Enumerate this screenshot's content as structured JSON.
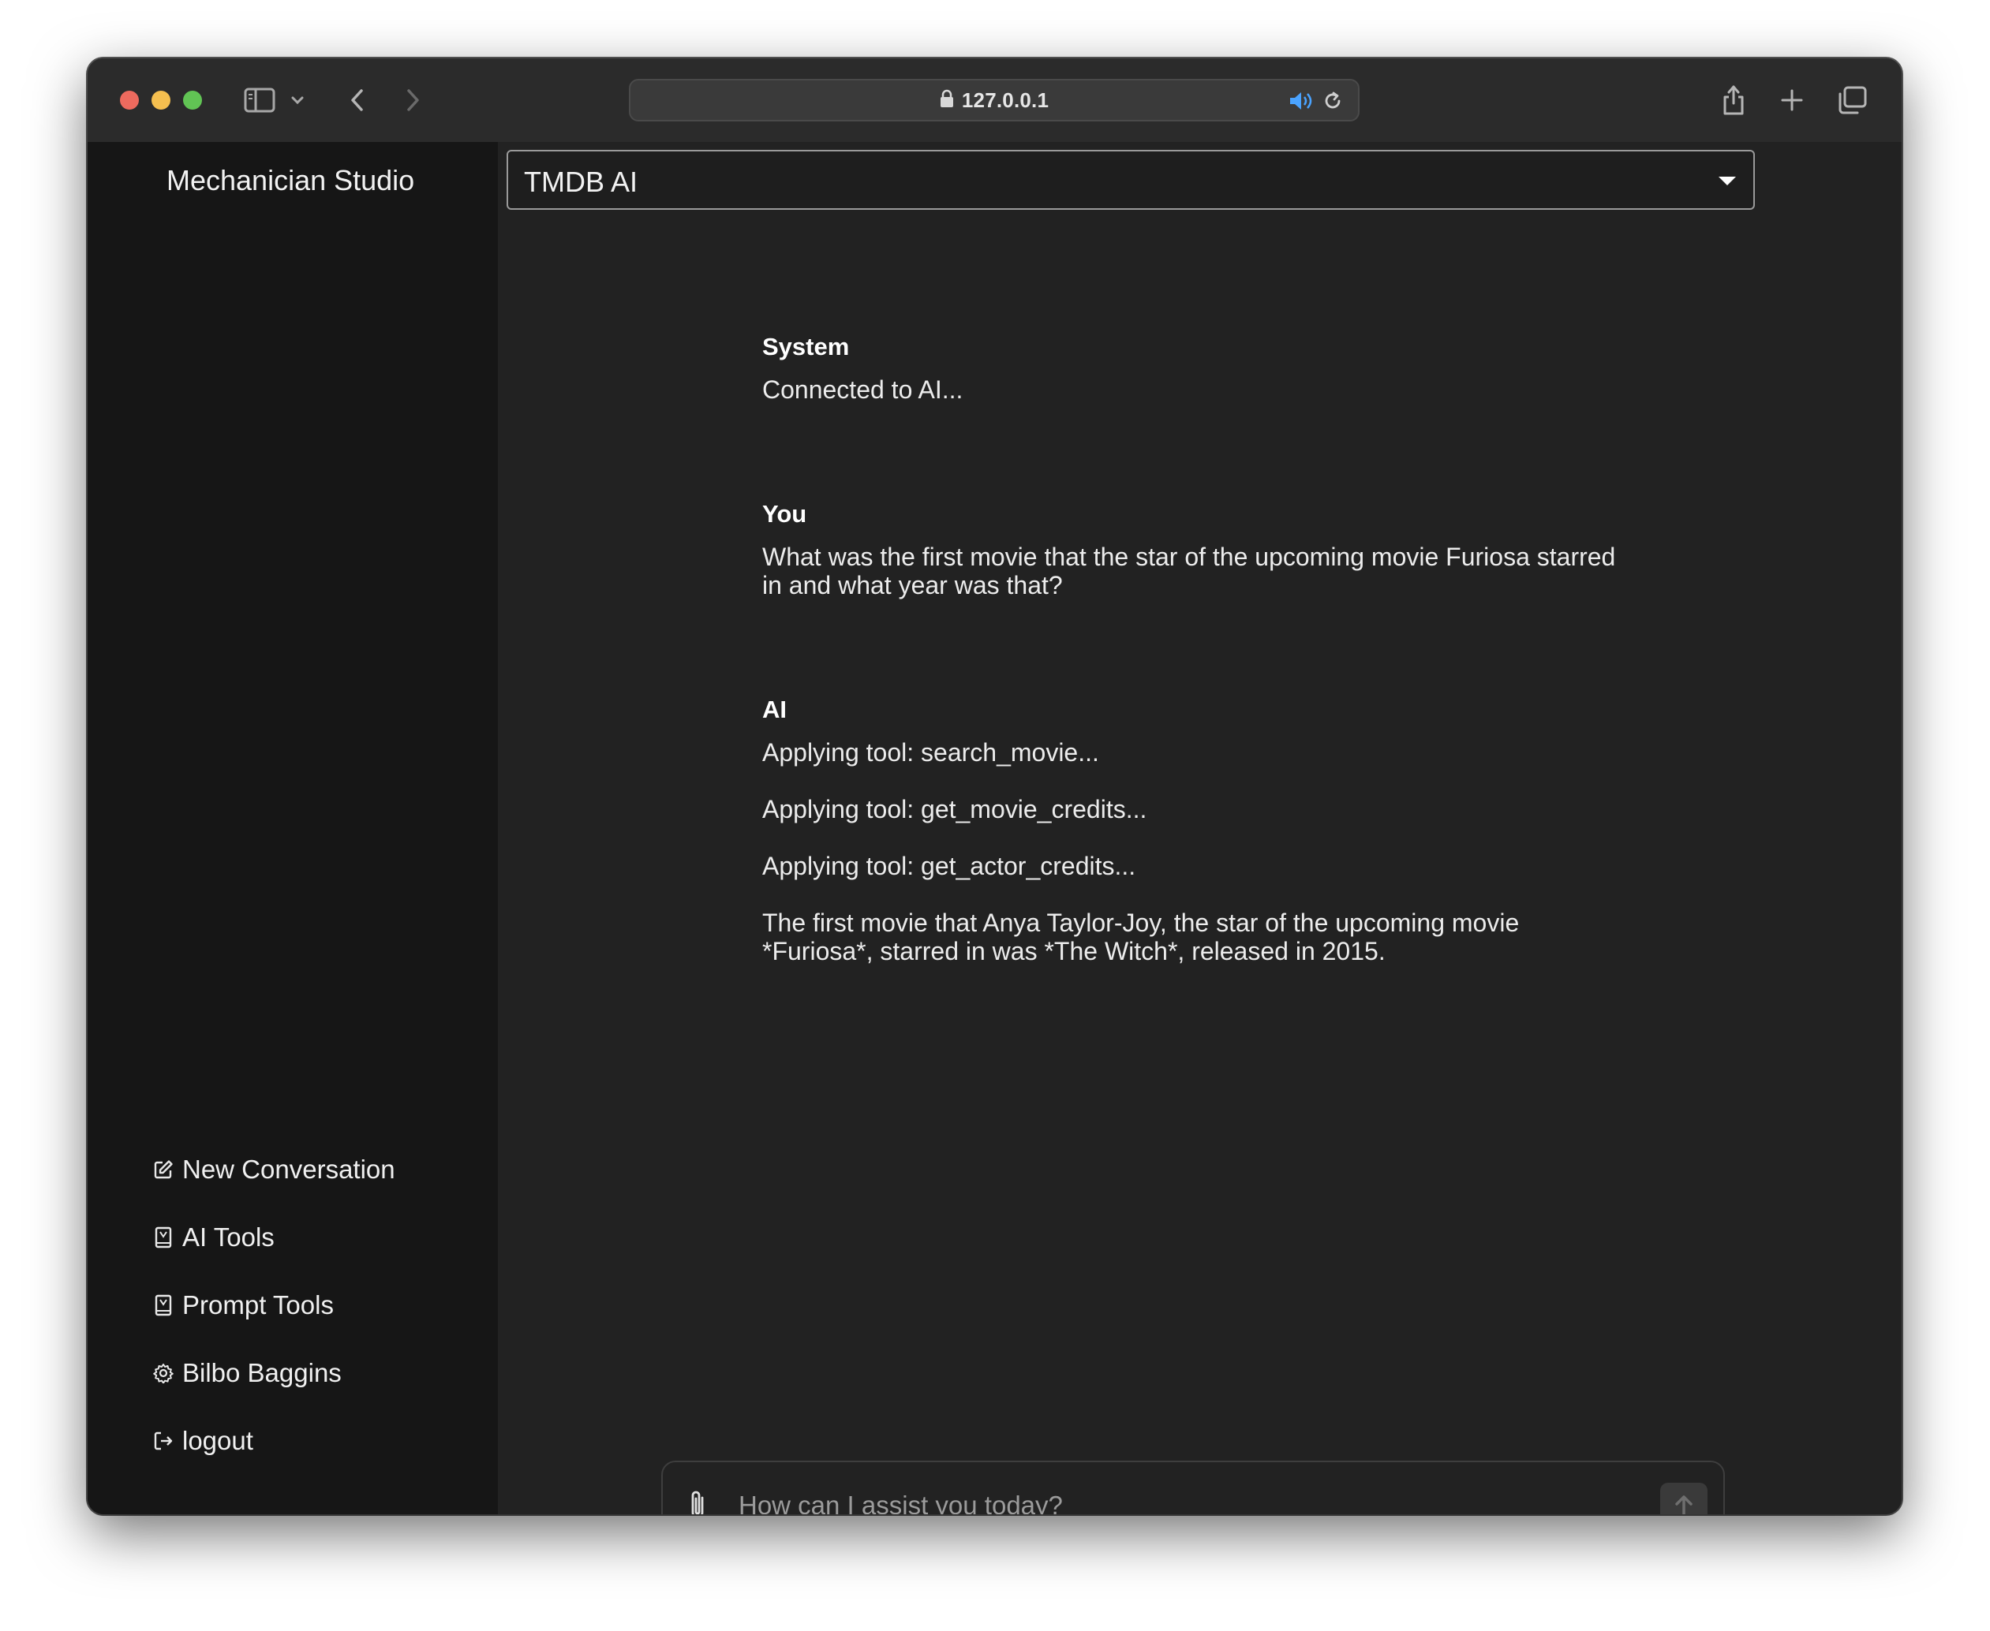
{
  "browser": {
    "address": "127.0.0.1",
    "icons": [
      "sidebar-icon",
      "chevron-down-icon",
      "back-icon",
      "forward-icon",
      "lock-icon",
      "sound-icon",
      "reload-icon",
      "share-icon",
      "plus-icon",
      "tabs-icon"
    ]
  },
  "sidebar": {
    "brand": "Mechanician Studio",
    "items": [
      {
        "label": "New Conversation",
        "icon": "edit-icon"
      },
      {
        "label": "AI Tools",
        "icon": "book-icon"
      },
      {
        "label": "Prompt Tools",
        "icon": "book-icon"
      },
      {
        "label": "Bilbo Baggins",
        "icon": "gear-icon"
      },
      {
        "label": "logout",
        "icon": "logout-icon"
      }
    ]
  },
  "main": {
    "model_select": "TMDB AI",
    "messages": [
      {
        "author": "System",
        "lines": [
          "Connected to AI..."
        ]
      },
      {
        "author": "You",
        "lines": [
          "What was the first movie that the star of the upcoming movie Furiosa starred in and what year was that?"
        ]
      },
      {
        "author": "AI",
        "lines": [
          "Applying tool: search_movie...",
          "Applying tool: get_movie_credits...",
          "Applying tool: get_actor_credits...",
          "The first movie that Anya Taylor-Joy, the star of the upcoming movie *Furiosa*, starred in was *The Witch*, released in 2015."
        ]
      }
    ],
    "composer": {
      "placeholder": "How can I assist you today?",
      "value": ""
    }
  },
  "colors": {
    "sidebar_bg": "#161616",
    "main_bg": "#222222",
    "titlebar_bg": "#2b2b2b",
    "text": "#ececec"
  }
}
